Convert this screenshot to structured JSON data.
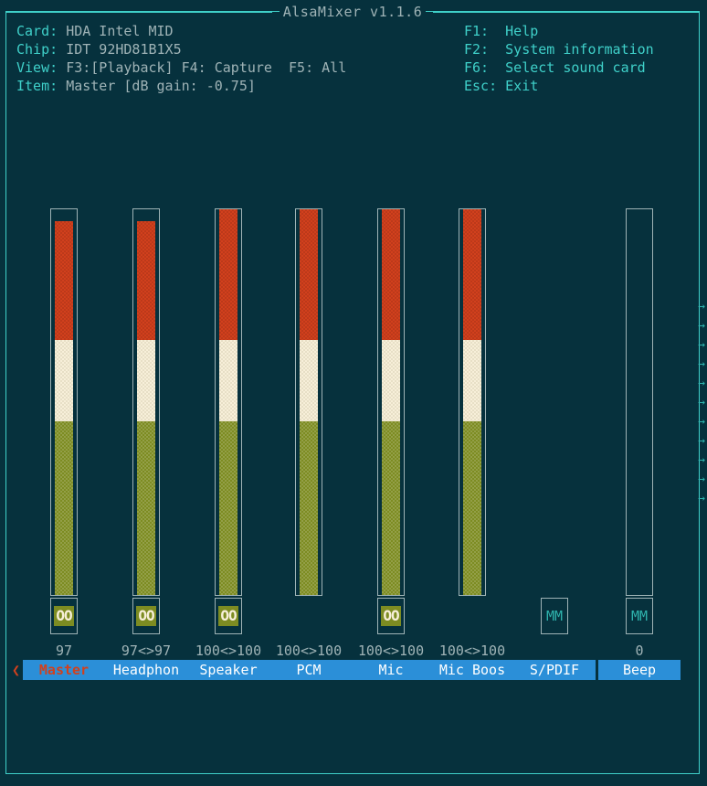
{
  "window": {
    "title": "AlsaMixer v1.1.6"
  },
  "header": {
    "card_label": "Card:",
    "card_value": "HDA Intel MID",
    "chip_label": "Chip:",
    "chip_value": "IDT 92HD81B1X5",
    "view_label": "View:",
    "view_value": "F3:[Playback] F4: Capture  F5: All",
    "item_label": "Item:",
    "item_value": "Master [dB gain: -0.75]",
    "keys": [
      {
        "key": "F1:",
        "desc": "Help"
      },
      {
        "key": "F2:",
        "desc": "System information"
      },
      {
        "key": "F6:",
        "desc": "Select sound card"
      },
      {
        "key": "Esc:",
        "desc": "Exit"
      }
    ]
  },
  "colors": {
    "background": "#06313d",
    "frame": "#3fd0c9",
    "bar_border": "#9fb3b6",
    "bar_red": "#d1401d",
    "bar_white": "#f7efd9",
    "bar_green": "#7d8c22",
    "label_bg": "#2b8fd8",
    "label_fg": "#ffffff",
    "selected_fg": "#d1401d",
    "text_cyan": "#3fd0c9",
    "text_gray": "#9fb3b6"
  },
  "channels": [
    {
      "name": "Master",
      "label": "Master",
      "value_text": "97",
      "left_volume": 97,
      "right_volume": 97,
      "has_bar": true,
      "bar_percent": 97,
      "mute_state": "OO",
      "selected": true
    },
    {
      "name": "Headphone",
      "label": "Headphon",
      "value_text": "97<>97",
      "left_volume": 97,
      "right_volume": 97,
      "has_bar": true,
      "bar_percent": 97,
      "mute_state": "OO",
      "selected": false
    },
    {
      "name": "Speaker",
      "label": "Speaker",
      "value_text": "100<>100",
      "left_volume": 100,
      "right_volume": 100,
      "has_bar": true,
      "bar_percent": 100,
      "mute_state": "OO",
      "selected": false
    },
    {
      "name": "PCM",
      "label": "PCM",
      "value_text": "100<>100",
      "left_volume": 100,
      "right_volume": 100,
      "has_bar": true,
      "bar_percent": 100,
      "mute_state": "",
      "selected": false
    },
    {
      "name": "Mic",
      "label": "Mic",
      "value_text": "100<>100",
      "left_volume": 100,
      "right_volume": 100,
      "has_bar": true,
      "bar_percent": 100,
      "mute_state": "OO",
      "selected": false
    },
    {
      "name": "Mic Boost",
      "label": "Mic Boos",
      "value_text": "100<>100",
      "left_volume": 100,
      "right_volume": 100,
      "has_bar": true,
      "bar_percent": 100,
      "mute_state": "",
      "selected": false
    },
    {
      "name": "S/PDIF",
      "label": "S/PDIF",
      "value_text": "",
      "left_volume": null,
      "right_volume": null,
      "has_bar": false,
      "bar_percent": 0,
      "mute_state": "MM",
      "selected": false
    },
    {
      "name": "Beep",
      "label": "Beep",
      "value_text": "0",
      "left_volume": 0,
      "right_volume": 0,
      "has_bar": true,
      "bar_percent": 0,
      "mute_state": "MM",
      "selected": false
    }
  ],
  "scroll_arrows": {
    "glyph": "→",
    "count": 11
  },
  "selection": {
    "left_arrow": "❮",
    "right_arrow": "❯"
  }
}
